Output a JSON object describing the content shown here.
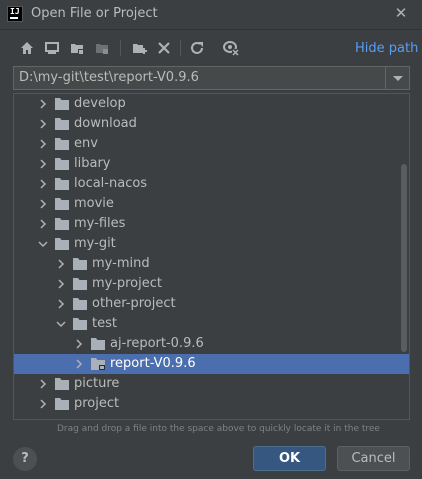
{
  "window": {
    "title": "Open File or Project",
    "app_icon_text": "IJ"
  },
  "toolbar": {
    "icons": [
      "home-icon",
      "desktop-icon",
      "project-folder-icon",
      "module-folder-icon",
      "new-folder-icon",
      "delete-icon",
      "refresh-icon",
      "show-hidden-icon"
    ],
    "hide_path_label": "Hide path"
  },
  "path": {
    "value": "D:\\my-git\\test\\report-V0.9.6"
  },
  "tree": {
    "rows": [
      {
        "label": "develop"
      },
      {
        "label": "download"
      },
      {
        "label": "env"
      },
      {
        "label": "libary"
      },
      {
        "label": "local-nacos"
      },
      {
        "label": "movie"
      },
      {
        "label": "my-files"
      },
      {
        "label": "my-git",
        "expanded": true
      },
      {
        "label": "my-mind"
      },
      {
        "label": "my-project"
      },
      {
        "label": "other-project"
      },
      {
        "label": "test",
        "expanded": true
      },
      {
        "label": "aj-report-0.9.6"
      },
      {
        "label": "report-V0.9.6",
        "selected": true
      },
      {
        "label": "picture"
      },
      {
        "label": "project"
      }
    ]
  },
  "hint": "Drag and drop a file into the space above to quickly locate it in the tree",
  "buttons": {
    "help": "?",
    "ok": "OK",
    "cancel": "Cancel"
  },
  "colors": {
    "background": "#3c3f41",
    "selection": "#4b6eaf",
    "link": "#589df6",
    "primary_button": "#365880"
  }
}
